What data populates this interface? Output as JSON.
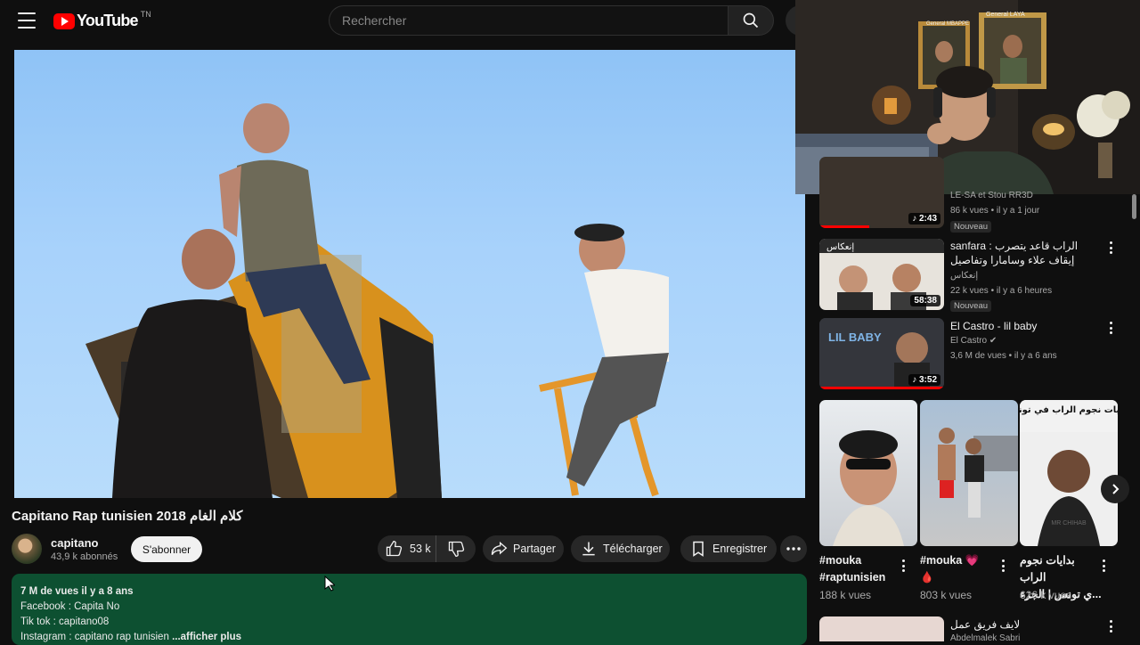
{
  "header": {
    "logo_text": "YouTube",
    "logo_country": "TN",
    "search_placeholder": "Rechercher"
  },
  "video": {
    "title": "Capitano Rap tunisien 2018 كلام الغام",
    "channel": "capitano",
    "subscribers": "43,9 k abonnés",
    "subscribe_label": "S'abonner",
    "likes": "53 k",
    "share_label": "Partager",
    "download_label": "Télécharger",
    "save_label": "Enregistrer"
  },
  "description": {
    "meta": "7 M de vues  il y a 8 ans",
    "lines": [
      "Facebook : Capita No",
      "Tik tok : capitano08",
      "Instagram : capitano rap tunisien"
    ],
    "more_label": "...afficher plus"
  },
  "sidebar": {
    "items": [
      {
        "title": "",
        "channel": "LE-SA et Stou RR3D",
        "meta": "86 k vues • il y a 1 jour",
        "badge": "Nouveau",
        "duration": "2:43",
        "progress": 0.4
      },
      {
        "title": "sanfara : الراب قاعد يتصرب إيقاف علاء وسامارا وتفاصيل المرحلة الجديدة",
        "channel": "إنعكاس",
        "meta": "22 k vues • il y a 6 heures",
        "badge": "Nouveau",
        "duration": "58:38",
        "thumb_text": "إنعكاس"
      },
      {
        "title": "El Castro - lil baby",
        "channel": "El Castro",
        "meta": "3,6 M de vues • il y a 6 ans",
        "duration": "3:52",
        "progress": 1.0,
        "thumb_text": "LIL BABY"
      },
      {
        "title": "لايف فريق عمل",
        "channel": "Abdelmalek Sabri"
      }
    ],
    "shorts": [
      {
        "title_line1": "#mouka",
        "title_line2": "#raptunisien",
        "views": "188 k vues"
      },
      {
        "title_line1": "#mouka 💗",
        "title_line2": "🩸",
        "views": "803 k vues"
      },
      {
        "title_line1": "بدايات نجوم الراب",
        "title_line2": "...ي تونس | الجزء",
        "views": "626 k vues",
        "thumb_text": "بدايات نجوم الراب في تونس",
        "thumb_sub": "MR CHIHAB"
      }
    ]
  },
  "webcam": {
    "frame1": "General MBAPPE",
    "frame2": "General LAYA"
  },
  "colors": {
    "accent": "#ff0000",
    "description_bg": "#0d5031"
  }
}
